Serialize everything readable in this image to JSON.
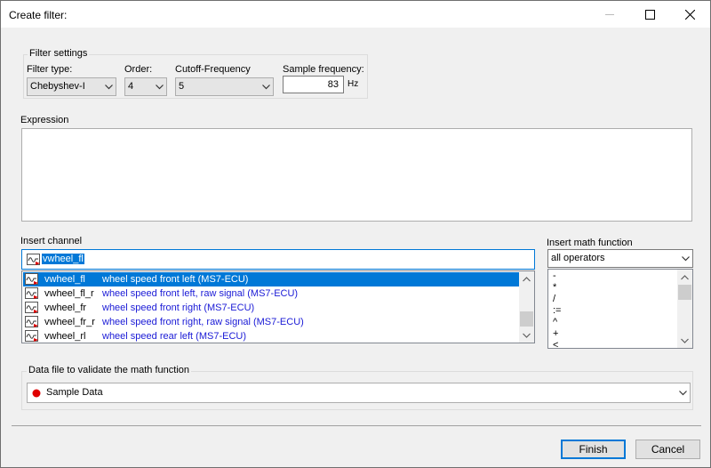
{
  "window": {
    "title": "Create filter:"
  },
  "filter_settings": {
    "legend": "Filter settings",
    "type_label": "Filter type:",
    "type_value": "Chebyshev-I",
    "order_label": "Order:",
    "order_value": "4",
    "cutoff_label": "Cutoff-Frequency",
    "cutoff_value": "5",
    "sample_label": "Sample frequency:",
    "sample_value": "83",
    "sample_unit": "Hz"
  },
  "expression": {
    "label": "Expression",
    "value": ""
  },
  "insert_channel": {
    "label": "Insert channel",
    "search_value": "vwheel_fl",
    "rows": [
      {
        "name": "vwheel_fl",
        "desc": "wheel speed front left (MS7-ECU)",
        "selected": true
      },
      {
        "name": "vwheel_fl_r",
        "desc": "wheel speed front left, raw signal (MS7-ECU)",
        "selected": false
      },
      {
        "name": "vwheel_fr",
        "desc": "wheel speed front right (MS7-ECU)",
        "selected": false
      },
      {
        "name": "vwheel_fr_r",
        "desc": "wheel speed front right, raw signal (MS7-ECU)",
        "selected": false
      },
      {
        "name": "vwheel_rl",
        "desc": "wheel speed rear left (MS7-ECU)",
        "selected": false
      }
    ]
  },
  "insert_math": {
    "label": "Insert math function",
    "category_value": "all operators",
    "operators": [
      "-",
      "*",
      "/",
      ":=",
      "^",
      "+",
      "<"
    ]
  },
  "data_file": {
    "legend": "Data file to validate the math function",
    "value": "Sample Data",
    "status_color": "#e00000"
  },
  "buttons": {
    "finish": "Finish",
    "cancel": "Cancel"
  },
  "colors": {
    "accent": "#0078d7",
    "link_text": "#1a1ad6"
  }
}
